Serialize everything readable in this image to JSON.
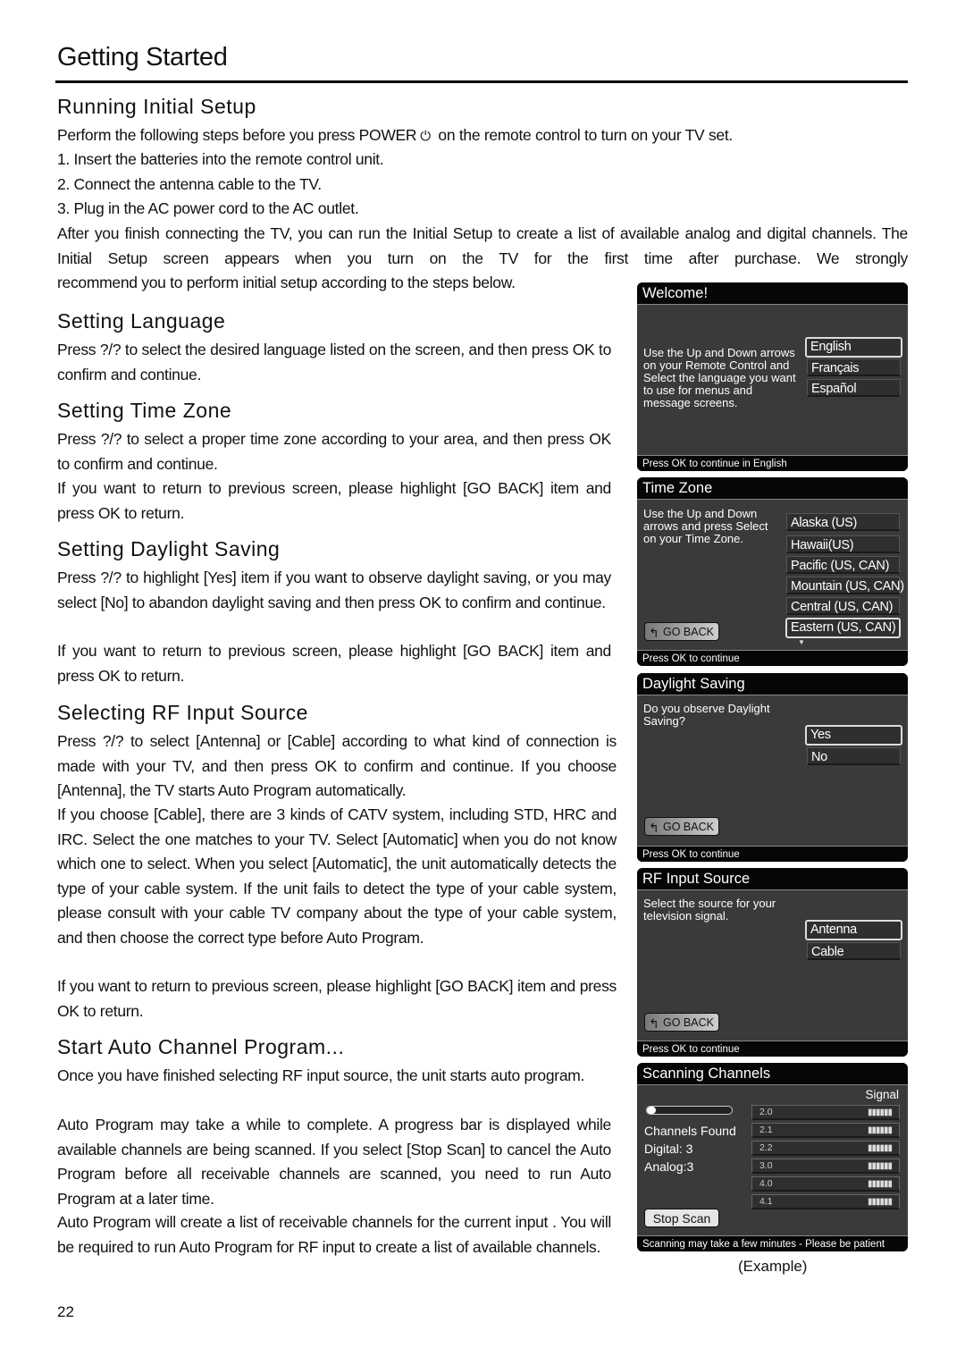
{
  "page": {
    "title": "Getting Started",
    "page_number": "22"
  },
  "sections": {
    "running": {
      "heading": "Running Initial Setup",
      "intro_before_icon": "Perform the following steps before you press POWER",
      "power_icon": "⏻",
      "intro_after_icon": " on the remote control to turn on your TV set.",
      "steps": [
        "1. Insert the batteries into the remote control unit.",
        "2. Connect the antenna cable to the TV.",
        "3. Plug in the AC power cord to the AC outlet."
      ],
      "para": "After you finish connecting the TV, you can run the Initial Setup to create a list of available analog and digital channels. The Initial Setup screen appears when you turn on the TV for the first time after purchase. We strongly",
      "para_end": "recommend you to perform initial setup according to the steps below."
    },
    "language": {
      "heading": "Setting Language",
      "para": "Press ?/? to select the desired language listed on the screen, and then press OK to confirm and continue."
    },
    "timezone": {
      "heading": "Setting Time Zone",
      "para1": "Press ?/? to select a proper time zone according to your area, and then press OK to confirm and continue.",
      "para2": "If you want to return to previous screen, please highlight [GO BACK] item and press OK to return."
    },
    "daylight": {
      "heading": "Setting Daylight Saving",
      "para1": "Press ?/? to highlight [Yes] item if you want to observe daylight saving, or you may select [No] to abandon daylight saving and then press OK to confirm and continue.",
      "para2": "If you want to return to previous screen, please highlight [GO BACK] item and press OK to return."
    },
    "rf": {
      "heading": "Selecting RF Input Source",
      "para1": "Press ?/? to select [Antenna] or [Cable] according to what kind of connection is made with your TV, and then press OK to confirm and continue. If you choose [Antenna], the TV starts Auto Program automatically.",
      "para2": "If you choose [Cable], there are 3 kinds of CATV system, including STD, HRC and IRC. Select the one matches to your TV. Select [Automatic] when you do not know which one to select. When you select [Automatic], the unit automatically detects the type of your cable system. If the unit fails to detect the type of your cable system, please consult with your cable TV company about the type of your cable system, and then choose the correct type before Auto Program.",
      "para3": "If you want to return to previous screen, please highlight [GO BACK] item and press OK to return."
    },
    "auto": {
      "heading": "Start Auto Channel Program...",
      "para1": "Once you have finished selecting RF input source, the unit starts auto program.",
      "para2": "Auto Program may take a while to complete. A progress bar is displayed while available channels are being scanned. If you select [Stop Scan] to cancel the Auto Program before all receivable channels are scanned, you need to run Auto Program at a later time.",
      "para3": "Auto Program will create a list of receivable channels for the current input . You will be required to run Auto Program for RF input to create a list of available channels."
    }
  },
  "screens": {
    "welcome": {
      "title": "Welcome!",
      "desc": "Use the Up and Down arrows on your Remote Control and Select the language you want to use for menus and message screens.",
      "options": [
        "English",
        "Français",
        "Español"
      ],
      "selected": "English",
      "footer": "Press OK to continue in English"
    },
    "timezone": {
      "title": "Time Zone",
      "desc": "Use the Up and Down arrows and press Select on your Time Zone.",
      "options": [
        "Alaska (US)",
        "Hawaii(US)",
        "Pacific (US, CAN)",
        "Mountain (US, CAN)",
        "Central (US, CAN)",
        "Eastern (US, CAN)"
      ],
      "selected": "Eastern (US, CAN)",
      "go_back": "GO BACK",
      "footer": "Press OK to continue"
    },
    "daylight": {
      "title": "Daylight Saving",
      "desc": "Do you observe Daylight Saving?",
      "options": [
        "Yes",
        "No"
      ],
      "selected": "Yes",
      "go_back": "GO BACK",
      "footer": "Press OK to continue"
    },
    "rf": {
      "title": "RF Input Source",
      "desc": "Select the source for your television signal.",
      "options": [
        "Antenna",
        "Cable"
      ],
      "selected": "Antenna",
      "go_back": "GO BACK",
      "footer": "Press OK to continue"
    },
    "scanning": {
      "title": "Scanning Channels",
      "signal_label": "Signal",
      "progress_fraction": 0.1,
      "channels_found_label": "Channels Found",
      "digital": "Digital: 3",
      "analog": "Analog:3",
      "channels": [
        "2.0",
        "2.1",
        "2.2",
        "3.0",
        "4.0",
        "4.1"
      ],
      "signal_bars": "▮▮▮▮▮▮",
      "stop_scan": "Stop Scan",
      "footer": "Scanning may take a few minutes - Please be patient"
    },
    "example_caption": "(Example)"
  }
}
